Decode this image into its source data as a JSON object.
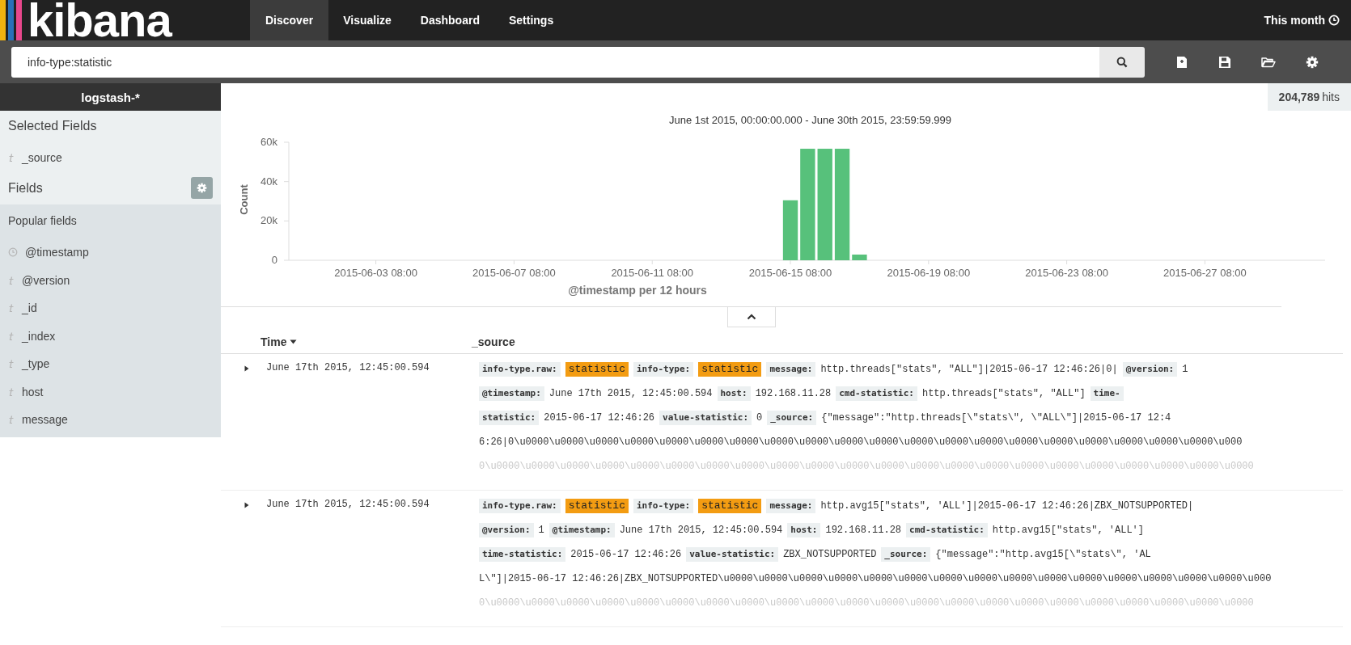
{
  "brand": "kibana",
  "nav": [
    {
      "label": "Discover",
      "selected": true
    },
    {
      "label": "Visualize",
      "selected": false
    },
    {
      "label": "Dashboard",
      "selected": false
    },
    {
      "label": "Settings",
      "selected": false
    }
  ],
  "time_picker": "This month",
  "search": {
    "value": "info-type:statistic"
  },
  "sidebar": {
    "index_pattern": "logstash-*",
    "selected_title": "Selected Fields",
    "selected_fields": [
      {
        "name": "_source",
        "kind": "string"
      }
    ],
    "fields_title": "Fields",
    "popular_title": "Popular fields",
    "popular_fields": [
      {
        "name": "@timestamp",
        "kind": "date"
      },
      {
        "name": "@version",
        "kind": "string"
      },
      {
        "name": "_id",
        "kind": "string"
      },
      {
        "name": "_index",
        "kind": "string"
      },
      {
        "name": "_type",
        "kind": "string"
      },
      {
        "name": "host",
        "kind": "string"
      },
      {
        "name": "message",
        "kind": "string"
      }
    ]
  },
  "hits": "**204,789** hits",
  "chart_data": {
    "type": "bar",
    "title": "June 1st 2015, 00:00:00.000 - June 30th 2015, 23:59:59.999",
    "xlabel": "@timestamp per 12 hours",
    "ylabel": "Count",
    "categories": [
      null,
      null,
      null,
      null,
      "2015-06-03 08:00",
      null,
      null,
      null,
      null,
      null,
      null,
      null,
      "2015-06-07 08:00",
      null,
      null,
      null,
      null,
      null,
      null,
      null,
      "2015-06-11 08:00",
      null,
      null,
      null,
      null,
      null,
      null,
      null,
      "2015-06-15 08:00",
      null,
      null,
      null,
      null,
      null,
      null,
      null,
      "2015-06-19 08:00",
      null,
      null,
      null,
      null,
      null,
      null,
      null,
      "2015-06-23 08:00",
      null,
      null,
      null,
      null,
      null,
      null,
      null,
      "2015-06-27 08:00",
      null,
      null,
      null,
      null,
      null,
      null,
      null
    ],
    "values": [
      null,
      null,
      null,
      null,
      null,
      null,
      null,
      null,
      null,
      null,
      null,
      null,
      null,
      null,
      null,
      null,
      null,
      null,
      null,
      null,
      null,
      null,
      null,
      null,
      null,
      null,
      null,
      null,
      30500,
      56700,
      56700,
      56700,
      2900,
      null,
      null,
      null,
      null,
      null,
      null,
      null,
      null,
      null,
      null,
      null,
      null,
      null,
      null,
      null,
      null,
      null,
      null,
      null,
      null,
      null,
      null,
      null,
      null,
      null,
      null,
      null
    ],
    "ylim": [
      0,
      60000
    ],
    "yticks": [
      {
        "value": 0,
        "label": "0"
      },
      {
        "value": 20000,
        "label": "20k"
      },
      {
        "value": 40000,
        "label": "40k"
      },
      {
        "value": 60000,
        "label": "60k"
      }
    ]
  },
  "table": {
    "columns": [
      "Time",
      "_source"
    ],
    "rows": [
      {
        "time": "June 17th 2015, 12:45:00.594",
        "lines": [
          [
            {
              "kind": "key",
              "text": "info-type.raw:"
            },
            {
              "kind": "highlight",
              "text": "statistic"
            },
            {
              "kind": "key",
              "text": "info-type:"
            },
            {
              "kind": "highlight",
              "text": "statistic"
            },
            {
              "kind": "key",
              "text": "message:"
            },
            {
              "kind": "text",
              "text": "http.threads[\"stats\", \"ALL\"]|2015-06-17 12:46:26|0|"
            },
            {
              "kind": "key",
              "text": "@version:"
            },
            {
              "kind": "text",
              "text": "1"
            }
          ],
          [
            {
              "kind": "key",
              "text": "@timestamp:"
            },
            {
              "kind": "text",
              "text": "June 17th 2015, 12:45:00.594"
            },
            {
              "kind": "key",
              "text": "host:"
            },
            {
              "kind": "text",
              "text": "192.168.11.28"
            },
            {
              "kind": "key",
              "text": "cmd-statistic:"
            },
            {
              "kind": "text",
              "text": "http.threads[\"stats\", \"ALL\"]"
            },
            {
              "kind": "key",
              "text": "time-"
            }
          ],
          [
            {
              "kind": "key",
              "text": "statistic:"
            },
            {
              "kind": "text",
              "text": "2015-06-17 12:46:26"
            },
            {
              "kind": "key",
              "text": "value-statistic:"
            },
            {
              "kind": "text",
              "text": "0"
            },
            {
              "kind": "key",
              "text": "_source:"
            },
            {
              "kind": "text",
              "text": "{\"message\":\"http.threads[\\\"stats\\\", \\\"ALL\\\"]|2015-06-17 12:4"
            }
          ],
          [
            {
              "kind": "text",
              "text": "6:26|0\\u0000\\u0000\\u0000\\u0000\\u0000\\u0000\\u0000\\u0000\\u0000\\u0000\\u0000\\u0000\\u0000\\u0000\\u0000\\u0000\\u0000\\u0000\\u0000\\u0000\\u000"
            }
          ],
          [
            {
              "kind": "text",
              "text": "0\\u0000\\u0000\\u0000\\u0000\\u0000\\u0000\\u0000\\u0000\\u0000\\u0000\\u0000\\u0000\\u0000\\u0000\\u0000\\u0000\\u0000\\u0000\\u0000\\u0000\\u0000\\u0000"
            }
          ]
        ]
      },
      {
        "time": "June 17th 2015, 12:45:00.594",
        "lines": [
          [
            {
              "kind": "key",
              "text": "info-type.raw:"
            },
            {
              "kind": "highlight",
              "text": "statistic"
            },
            {
              "kind": "key",
              "text": "info-type:"
            },
            {
              "kind": "highlight",
              "text": "statistic"
            },
            {
              "kind": "key",
              "text": "message:"
            },
            {
              "kind": "text",
              "text": "http.avg15[\"stats\", 'ALL']|2015-06-17 12:46:26|ZBX_NOTSUPPORTED|"
            }
          ],
          [
            {
              "kind": "key",
              "text": "@version:"
            },
            {
              "kind": "text",
              "text": "1"
            },
            {
              "kind": "key",
              "text": "@timestamp:"
            },
            {
              "kind": "text",
              "text": "June 17th 2015, 12:45:00.594"
            },
            {
              "kind": "key",
              "text": "host:"
            },
            {
              "kind": "text",
              "text": "192.168.11.28"
            },
            {
              "kind": "key",
              "text": "cmd-statistic:"
            },
            {
              "kind": "text",
              "text": "http.avg15[\"stats\", 'ALL']"
            }
          ],
          [
            {
              "kind": "key",
              "text": "time-statistic:"
            },
            {
              "kind": "text",
              "text": "2015-06-17 12:46:26"
            },
            {
              "kind": "key",
              "text": "value-statistic:"
            },
            {
              "kind": "text",
              "text": "ZBX_NOTSUPPORTED"
            },
            {
              "kind": "key",
              "text": "_source:"
            },
            {
              "kind": "text",
              "text": "{\"message\":\"http.avg15[\\\"stats\\\", 'AL"
            }
          ],
          [
            {
              "kind": "text",
              "text": "L\\\"]|2015-06-17 12:46:26|ZBX_NOTSUPPORTED\\u0000\\u0000\\u0000\\u0000\\u0000\\u0000\\u0000\\u0000\\u0000\\u0000\\u0000\\u0000\\u0000\\u0000\\u0000\\u000"
            }
          ],
          [
            {
              "kind": "text",
              "text": "0\\u0000\\u0000\\u0000\\u0000\\u0000\\u0000\\u0000\\u0000\\u0000\\u0000\\u0000\\u0000\\u0000\\u0000\\u0000\\u0000\\u0000\\u0000\\u0000\\u0000\\u0000\\u0000"
            }
          ]
        ]
      }
    ]
  }
}
